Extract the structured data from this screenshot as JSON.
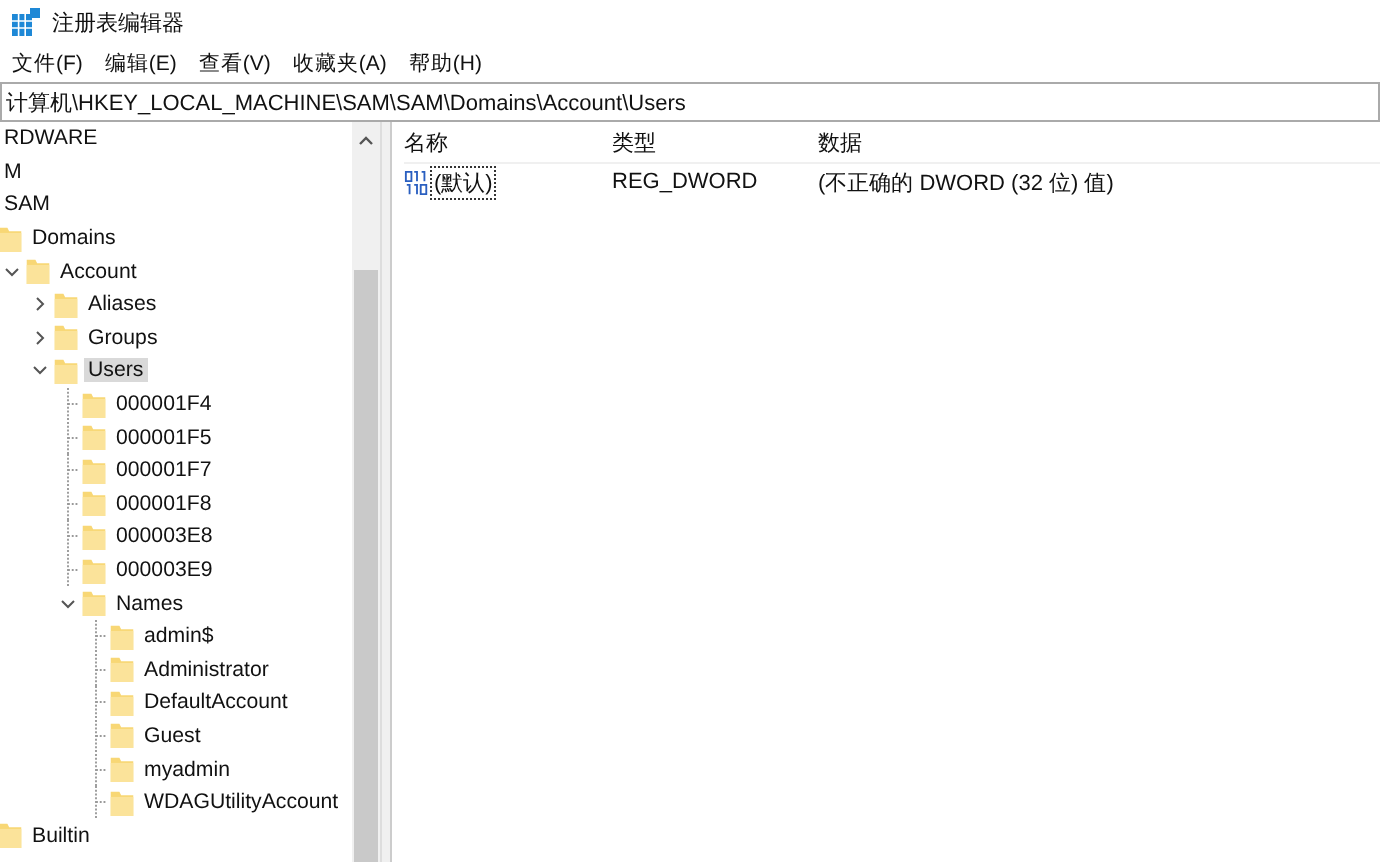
{
  "window": {
    "title": "注册表编辑器"
  },
  "menu": [
    "文件(F)",
    "编辑(E)",
    "查看(V)",
    "收藏夹(A)",
    "帮助(H)"
  ],
  "address": "计算机\\HKEY_LOCAL_MACHINE\\SAM\\SAM\\Domains\\Account\\Users",
  "tree": [
    {
      "label": "RDWARE",
      "selected": false
    },
    {
      "label": "M",
      "selected": false
    },
    {
      "label": "SAM",
      "selected": false,
      "children": [
        {
          "label": "Domains",
          "selected": false,
          "children": [
            {
              "label": "Account",
              "selected": false,
              "expanded": true,
              "children": [
                {
                  "label": "Aliases",
                  "selected": false,
                  "expanded": false
                },
                {
                  "label": "Groups",
                  "selected": false,
                  "expanded": false
                },
                {
                  "label": "Users",
                  "selected": true,
                  "expanded": true,
                  "children": [
                    {
                      "label": "000001F4",
                      "selected": false
                    },
                    {
                      "label": "000001F5",
                      "selected": false
                    },
                    {
                      "label": "000001F7",
                      "selected": false
                    },
                    {
                      "label": "000001F8",
                      "selected": false
                    },
                    {
                      "label": "000003E8",
                      "selected": false
                    },
                    {
                      "label": "000003E9",
                      "selected": false
                    },
                    {
                      "label": "Names",
                      "selected": false,
                      "expanded": true,
                      "children": [
                        {
                          "label": "admin$",
                          "selected": false
                        },
                        {
                          "label": "Administrator",
                          "selected": false
                        },
                        {
                          "label": "DefaultAccount",
                          "selected": false
                        },
                        {
                          "label": "Guest",
                          "selected": false
                        },
                        {
                          "label": "myadmin",
                          "selected": false
                        },
                        {
                          "label": "WDAGUtilityAccount",
                          "selected": false
                        }
                      ]
                    }
                  ]
                }
              ]
            }
          ]
        },
        {
          "label": "Builtin",
          "selected": false
        }
      ]
    }
  ],
  "values": {
    "columns": [
      "名称",
      "类型",
      "数据"
    ],
    "rows": [
      {
        "name": "(默认)",
        "type": "REG_DWORD",
        "data": "(不正确的 DWORD  (32 位) 值)",
        "selected": true
      }
    ]
  }
}
